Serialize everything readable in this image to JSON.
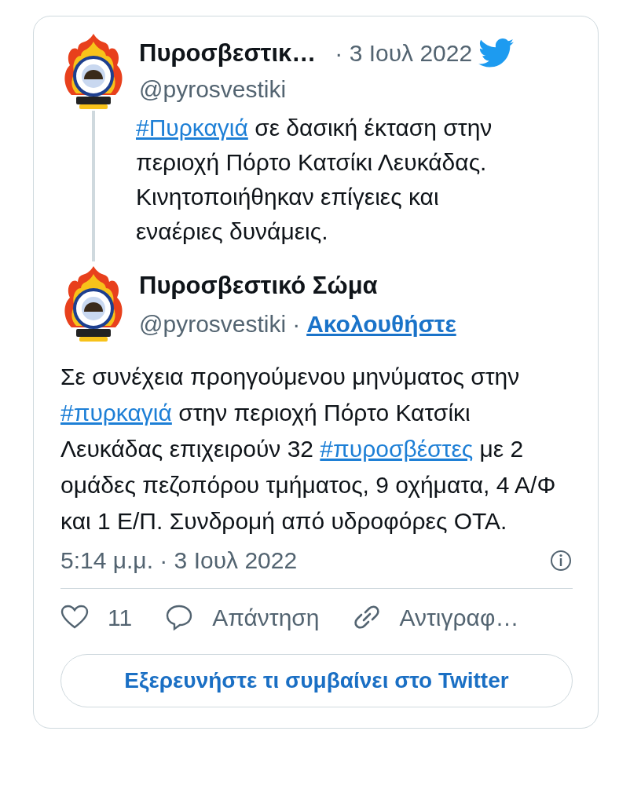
{
  "quoted_tweet": {
    "author_name": "Πυροσβεστικ…",
    "date": "· 3 Ιουλ 2022",
    "handle": "@pyrosvestiki",
    "text": [
      {
        "kind": "hashtag",
        "text": "#Πυρκαγιά"
      },
      {
        "kind": "text",
        "text": " σε δασική έκταση στην περιοχή Πόρτο Κατσίκι Λευκάδας. Κινητοποιήθηκαν επίγειες και εναέριες δυνάμεις."
      }
    ]
  },
  "tweet": {
    "author_name": "Πυροσβεστικό Σώμα",
    "handle": "@pyrosvestiki",
    "separator": "·",
    "follow_label": "Ακολουθήστε",
    "text": [
      {
        "kind": "text",
        "text": "Σε συνέχεια προηγούμενου μηνύματος στην "
      },
      {
        "kind": "hashtag",
        "text": "#πυρκαγιά"
      },
      {
        "kind": "text",
        "text": " στην περιοχή Πόρτο Κατσίκι Λευκάδας επιχειρούν 32 "
      },
      {
        "kind": "hashtag",
        "text": "#πυροσβέστες"
      },
      {
        "kind": "text",
        "text": " με 2 ομάδες πεζοπόρου τμήματος, 9 οχήματα, 4 Α/Φ και 1 Ε/Π. Συνδρομή από υδροφόρες ΟΤΑ."
      }
    ],
    "timestamp": "5:14 μ.μ. · 3 Ιουλ 2022"
  },
  "actions": [
    {
      "kind": "like",
      "label": "11"
    },
    {
      "kind": "reply",
      "label": "Απάντηση"
    },
    {
      "kind": "copy",
      "label": "Αντιγραφ…"
    }
  ],
  "explore_button": "Εξερευνήστε τι συμβαίνει στο Twitter"
}
